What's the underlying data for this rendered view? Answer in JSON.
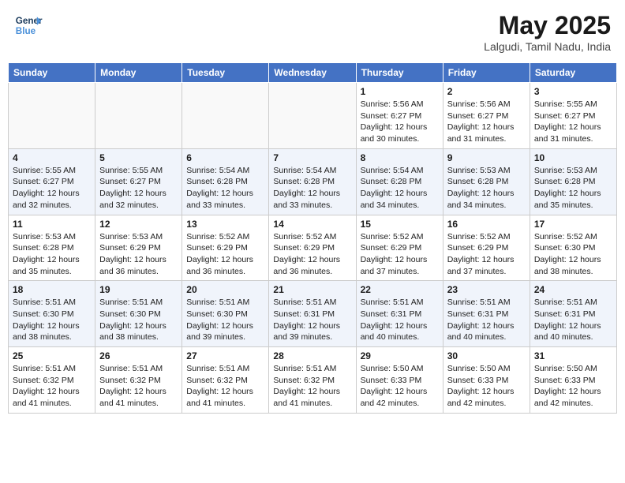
{
  "header": {
    "logo_line1": "General",
    "logo_line2": "Blue",
    "month_title": "May 2025",
    "location": "Lalgudi, Tamil Nadu, India"
  },
  "weekdays": [
    "Sunday",
    "Monday",
    "Tuesday",
    "Wednesday",
    "Thursday",
    "Friday",
    "Saturday"
  ],
  "weeks": [
    [
      {
        "day": "",
        "info": ""
      },
      {
        "day": "",
        "info": ""
      },
      {
        "day": "",
        "info": ""
      },
      {
        "day": "",
        "info": ""
      },
      {
        "day": "1",
        "info": "Sunrise: 5:56 AM\nSunset: 6:27 PM\nDaylight: 12 hours\nand 30 minutes."
      },
      {
        "day": "2",
        "info": "Sunrise: 5:56 AM\nSunset: 6:27 PM\nDaylight: 12 hours\nand 31 minutes."
      },
      {
        "day": "3",
        "info": "Sunrise: 5:55 AM\nSunset: 6:27 PM\nDaylight: 12 hours\nand 31 minutes."
      }
    ],
    [
      {
        "day": "4",
        "info": "Sunrise: 5:55 AM\nSunset: 6:27 PM\nDaylight: 12 hours\nand 32 minutes."
      },
      {
        "day": "5",
        "info": "Sunrise: 5:55 AM\nSunset: 6:27 PM\nDaylight: 12 hours\nand 32 minutes."
      },
      {
        "day": "6",
        "info": "Sunrise: 5:54 AM\nSunset: 6:28 PM\nDaylight: 12 hours\nand 33 minutes."
      },
      {
        "day": "7",
        "info": "Sunrise: 5:54 AM\nSunset: 6:28 PM\nDaylight: 12 hours\nand 33 minutes."
      },
      {
        "day": "8",
        "info": "Sunrise: 5:54 AM\nSunset: 6:28 PM\nDaylight: 12 hours\nand 34 minutes."
      },
      {
        "day": "9",
        "info": "Sunrise: 5:53 AM\nSunset: 6:28 PM\nDaylight: 12 hours\nand 34 minutes."
      },
      {
        "day": "10",
        "info": "Sunrise: 5:53 AM\nSunset: 6:28 PM\nDaylight: 12 hours\nand 35 minutes."
      }
    ],
    [
      {
        "day": "11",
        "info": "Sunrise: 5:53 AM\nSunset: 6:28 PM\nDaylight: 12 hours\nand 35 minutes."
      },
      {
        "day": "12",
        "info": "Sunrise: 5:53 AM\nSunset: 6:29 PM\nDaylight: 12 hours\nand 36 minutes."
      },
      {
        "day": "13",
        "info": "Sunrise: 5:52 AM\nSunset: 6:29 PM\nDaylight: 12 hours\nand 36 minutes."
      },
      {
        "day": "14",
        "info": "Sunrise: 5:52 AM\nSunset: 6:29 PM\nDaylight: 12 hours\nand 36 minutes."
      },
      {
        "day": "15",
        "info": "Sunrise: 5:52 AM\nSunset: 6:29 PM\nDaylight: 12 hours\nand 37 minutes."
      },
      {
        "day": "16",
        "info": "Sunrise: 5:52 AM\nSunset: 6:29 PM\nDaylight: 12 hours\nand 37 minutes."
      },
      {
        "day": "17",
        "info": "Sunrise: 5:52 AM\nSunset: 6:30 PM\nDaylight: 12 hours\nand 38 minutes."
      }
    ],
    [
      {
        "day": "18",
        "info": "Sunrise: 5:51 AM\nSunset: 6:30 PM\nDaylight: 12 hours\nand 38 minutes."
      },
      {
        "day": "19",
        "info": "Sunrise: 5:51 AM\nSunset: 6:30 PM\nDaylight: 12 hours\nand 38 minutes."
      },
      {
        "day": "20",
        "info": "Sunrise: 5:51 AM\nSunset: 6:30 PM\nDaylight: 12 hours\nand 39 minutes."
      },
      {
        "day": "21",
        "info": "Sunrise: 5:51 AM\nSunset: 6:31 PM\nDaylight: 12 hours\nand 39 minutes."
      },
      {
        "day": "22",
        "info": "Sunrise: 5:51 AM\nSunset: 6:31 PM\nDaylight: 12 hours\nand 40 minutes."
      },
      {
        "day": "23",
        "info": "Sunrise: 5:51 AM\nSunset: 6:31 PM\nDaylight: 12 hours\nand 40 minutes."
      },
      {
        "day": "24",
        "info": "Sunrise: 5:51 AM\nSunset: 6:31 PM\nDaylight: 12 hours\nand 40 minutes."
      }
    ],
    [
      {
        "day": "25",
        "info": "Sunrise: 5:51 AM\nSunset: 6:32 PM\nDaylight: 12 hours\nand 41 minutes."
      },
      {
        "day": "26",
        "info": "Sunrise: 5:51 AM\nSunset: 6:32 PM\nDaylight: 12 hours\nand 41 minutes."
      },
      {
        "day": "27",
        "info": "Sunrise: 5:51 AM\nSunset: 6:32 PM\nDaylight: 12 hours\nand 41 minutes."
      },
      {
        "day": "28",
        "info": "Sunrise: 5:51 AM\nSunset: 6:32 PM\nDaylight: 12 hours\nand 41 minutes."
      },
      {
        "day": "29",
        "info": "Sunrise: 5:50 AM\nSunset: 6:33 PM\nDaylight: 12 hours\nand 42 minutes."
      },
      {
        "day": "30",
        "info": "Sunrise: 5:50 AM\nSunset: 6:33 PM\nDaylight: 12 hours\nand 42 minutes."
      },
      {
        "day": "31",
        "info": "Sunrise: 5:50 AM\nSunset: 6:33 PM\nDaylight: 12 hours\nand 42 minutes."
      }
    ]
  ]
}
